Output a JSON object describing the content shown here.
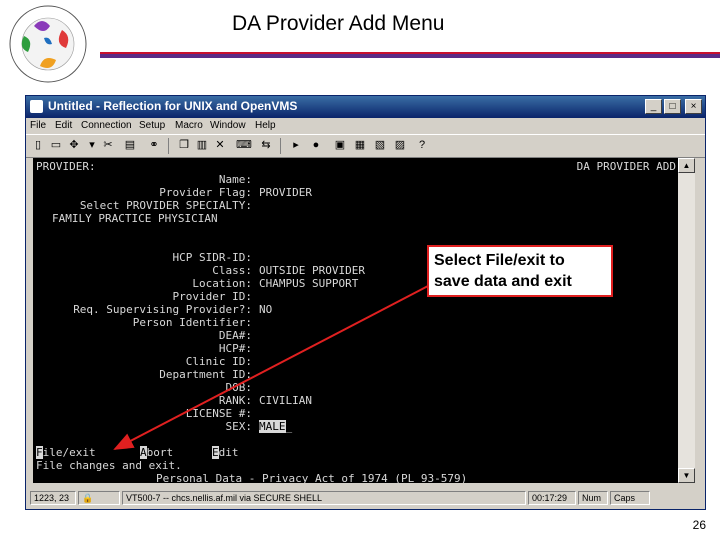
{
  "slide": {
    "title": "DA Provider Add Menu",
    "page_number": "26"
  },
  "window": {
    "title": "Untitled - Reflection for UNIX and OpenVMS",
    "controls": {
      "minimize": "_",
      "maximize": "□",
      "close": "×"
    },
    "menu": [
      "File",
      "Edit",
      "Connection",
      "Setup",
      "Macro",
      "Window",
      "Help"
    ]
  },
  "terminal": {
    "header_left": "PROVIDER:",
    "header_right": "DA PROVIDER ADD",
    "lines": [
      {
        "label": "Name:",
        "value": ""
      },
      {
        "label": "Provider Flag:",
        "value": "PROVIDER"
      },
      {
        "label": "Select PROVIDER SPECIALTY:",
        "value": ""
      },
      {
        "label": "FAMILY PRACTICE PHYSICIAN",
        "value": ""
      },
      {
        "label": "HCP SIDR-ID:",
        "value": ""
      },
      {
        "label": "Class:",
        "value": "OUTSIDE PROVIDER"
      },
      {
        "label": "Location:",
        "value": "CHAMPUS SUPPORT"
      },
      {
        "label": "Provider ID:",
        "value": ""
      },
      {
        "label": "Req. Supervising Provider?:",
        "value": "NO"
      },
      {
        "label": "Person Identifier:",
        "value": ""
      },
      {
        "label": "DEA#:",
        "value": ""
      },
      {
        "label": "HCP#:",
        "value": ""
      },
      {
        "label": "Clinic ID:",
        "value": ""
      },
      {
        "label": "Department ID:",
        "value": ""
      },
      {
        "label": "DOB:",
        "value": ""
      },
      {
        "label": "RANK:",
        "value": "CIVILIAN"
      },
      {
        "label": "LICENSE #:",
        "value": ""
      },
      {
        "label": "SEX:",
        "value": "MALE"
      }
    ],
    "actions": {
      "file_key": "F",
      "file_rest": "ile/exit",
      "abort_key": "A",
      "abort_rest": "bort",
      "edit_key": "E",
      "edit_rest": "dit"
    },
    "help_line": "File changes and exit.",
    "footer": "Personal Data - Privacy Act of 1974 (PL 93-579)"
  },
  "statusbar": {
    "cursor": "1223, 23",
    "session": "VT500-7 -- chcs.nellis.af.mil via SECURE SHELL",
    "time": "00:17:29",
    "num": "Num",
    "caps": "Caps"
  },
  "callout": {
    "line1": "Select File/exit to",
    "line2": "save data and exit"
  }
}
